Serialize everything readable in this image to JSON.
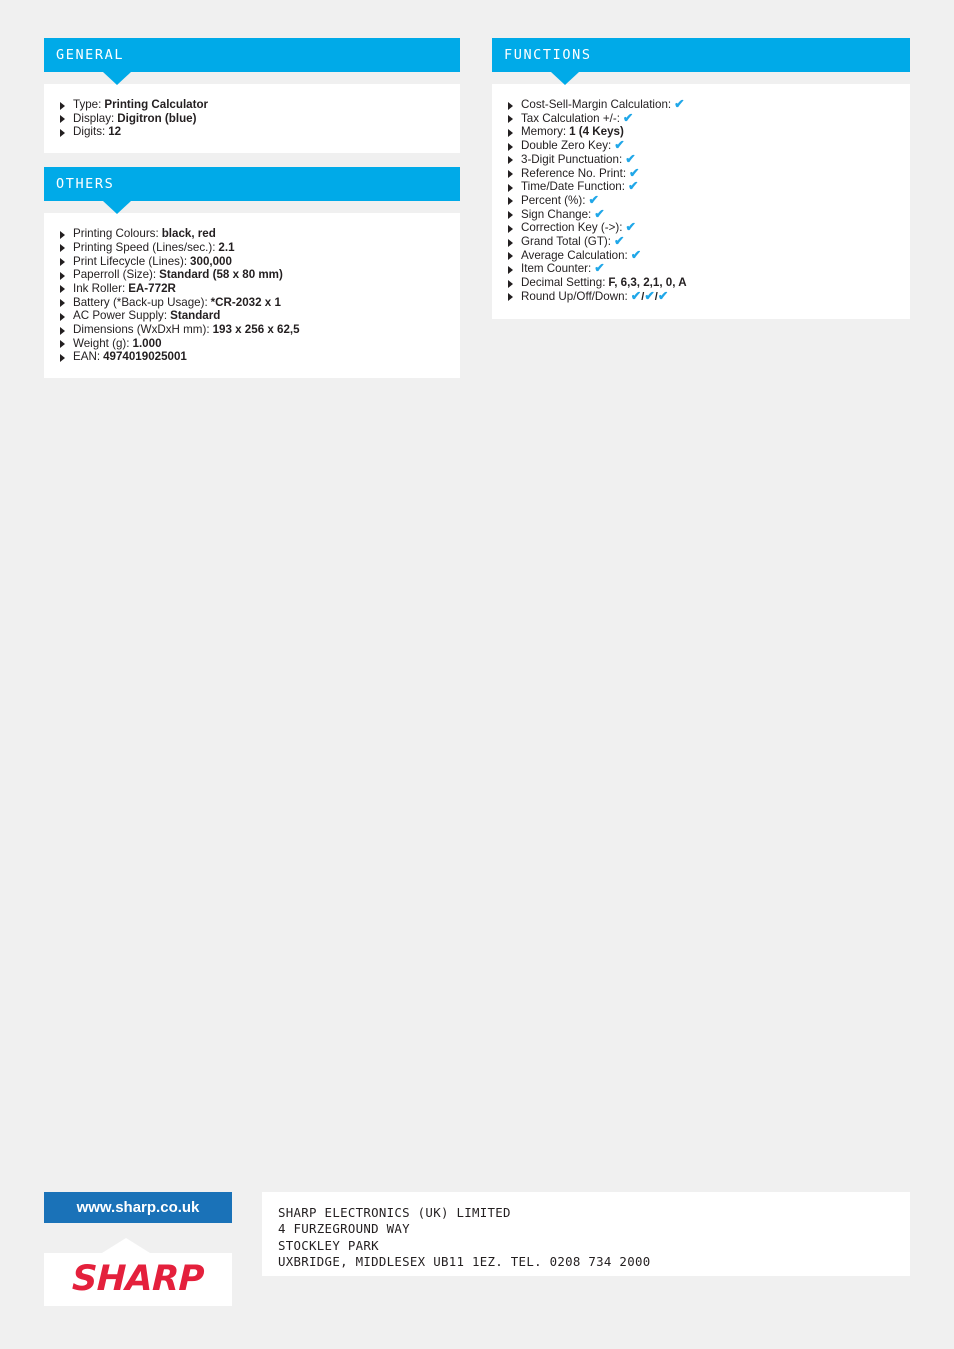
{
  "page": {
    "background_color": "#f0f0f0",
    "accent_color": "#00aae8",
    "check_color": "#20a7e8",
    "link_badge_color": "#1a72b8",
    "logo_color": "#e4203c"
  },
  "panels": {
    "general": {
      "title": "GENERAL",
      "items": [
        {
          "label": "Type:",
          "value": "Printing Calculator"
        },
        {
          "label": "Display:",
          "value": "Digitron (blue)"
        },
        {
          "label": "Digits:",
          "value": "12"
        }
      ]
    },
    "others": {
      "title": "OTHERS",
      "items": [
        {
          "label": "Printing Colours:",
          "value": "black, red"
        },
        {
          "label": "Printing Speed (Lines/sec.):",
          "value": "2.1"
        },
        {
          "label": "Print Lifecycle (Lines):",
          "value": "300,000"
        },
        {
          "label": "Paperroll (Size):",
          "value": "Standard (58 x 80 mm)"
        },
        {
          "label": "Ink Roller:",
          "value": "EA-772R"
        },
        {
          "label": "Battery (*Back-up Usage):",
          "value": "*CR-2032 x 1"
        },
        {
          "label": "AC Power Supply:",
          "value": "Standard"
        },
        {
          "label": "Dimensions (WxDxH mm):",
          "value": "193 x 256 x 62,5"
        },
        {
          "label": "Weight (g):",
          "value": "1.000"
        },
        {
          "label": "EAN:",
          "value": "4974019025001"
        }
      ]
    },
    "functions": {
      "title": "FUNCTIONS",
      "items": [
        {
          "label": "Cost-Sell-Margin Calculation:",
          "value": "✔",
          "is_check": true
        },
        {
          "label": "Tax Calculation +/-:",
          "value": "✔",
          "is_check": true
        },
        {
          "label": "Memory:",
          "value": "1 (4 Keys)",
          "is_check": false
        },
        {
          "label": "Double Zero Key:",
          "value": "✔",
          "is_check": true
        },
        {
          "label": "3-Digit Punctuation:",
          "value": "✔",
          "is_check": true
        },
        {
          "label": "Reference No. Print:",
          "value": "✔",
          "is_check": true
        },
        {
          "label": "Time/Date Function:",
          "value": "✔",
          "is_check": true
        },
        {
          "label": "Percent (%):",
          "value": "✔",
          "is_check": true
        },
        {
          "label": "Sign Change:",
          "value": "✔",
          "is_check": true
        },
        {
          "label": "Correction Key (->):",
          "value": "✔",
          "is_check": true
        },
        {
          "label": "Grand Total (GT):",
          "value": "✔",
          "is_check": true
        },
        {
          "label": "Average Calculation:",
          "value": "✔",
          "is_check": true
        },
        {
          "label": "Item Counter:",
          "value": "✔",
          "is_check": true
        },
        {
          "label": "Decimal Setting:",
          "value": "F, 6,3, 2,1, 0, A",
          "is_check": false
        },
        {
          "label": "Round Up/Off/Down:",
          "value": "✔/✔/✔",
          "is_check": true
        }
      ]
    }
  },
  "footer": {
    "website_label": "www.sharp.co.uk",
    "logo_text": "SHARP",
    "address_lines": [
      "SHARP ELECTRONICS (UK) LIMITED",
      "4 FURZEGROUND WAY",
      "STOCKLEY PARK",
      "UXBRIDGE, MIDDLESEX UB11 1EZ. TEL. 0208 734 2000"
    ]
  }
}
